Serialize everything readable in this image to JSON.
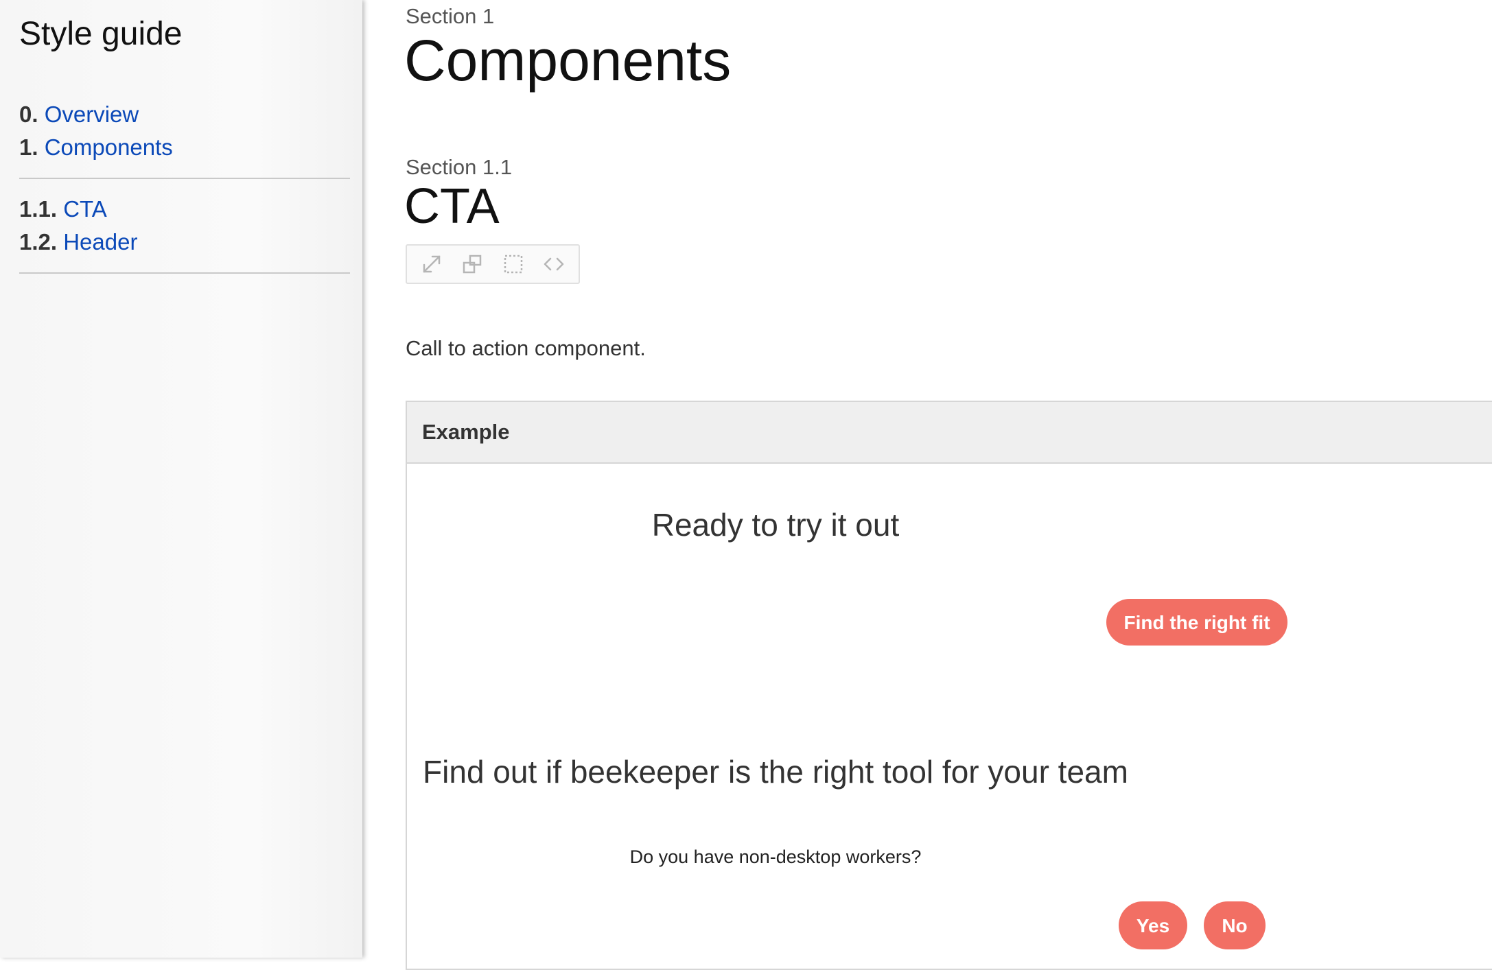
{
  "sidebar": {
    "title": "Style guide",
    "primary": [
      {
        "num": "0.",
        "label": "Overview"
      },
      {
        "num": "1.",
        "label": "Components"
      }
    ],
    "secondary": [
      {
        "num": "1.1.",
        "label": "CTA"
      },
      {
        "num": "1.2.",
        "label": "Header"
      }
    ]
  },
  "main": {
    "section_label": "Section 1",
    "title": "Components",
    "subsection_label": "Section 1.1",
    "subsection_title": "CTA",
    "toolbar": [
      "expand-icon",
      "new-window-icon",
      "outline-icon",
      "code-icon"
    ],
    "description": "Call to action component.",
    "example": {
      "header": "Example",
      "cta_heading": "Ready to try it out",
      "cta_button": "Find the right fit",
      "question_heading": "Find out if beekeeper is the right tool for your team",
      "question": "Do you have non-desktop workers?",
      "yes_label": "Yes",
      "no_label": "No"
    }
  },
  "colors": {
    "link": "#0b49b8",
    "accent": "#f26f64",
    "header_bg": "#efefef"
  }
}
